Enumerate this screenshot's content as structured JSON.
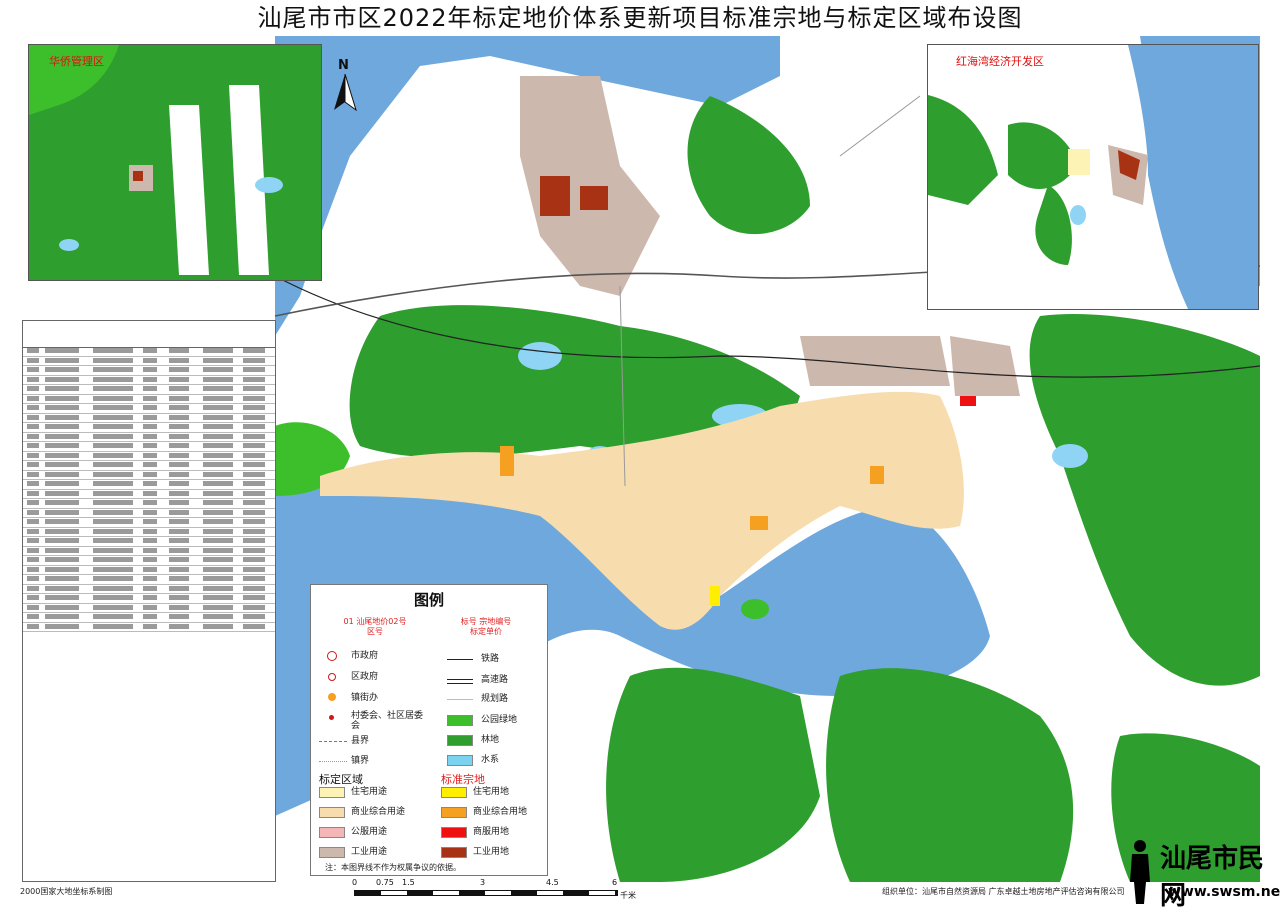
{
  "title": "汕尾市市区2022年标定地价体系更新项目标准宗地与标定区域布设图",
  "north_label": "N",
  "insets": {
    "left_label": "华侨管理区",
    "right_label": "红海湾经济开发区"
  },
  "legend": {
    "title": "图例",
    "red_note_left": "01 汕尾地价02号\n区号",
    "red_note_right": "标号 宗地编号\n标定单价",
    "symbols": [
      {
        "label": "市政府",
        "icon": "government-icon"
      },
      {
        "label": "区政府",
        "icon": "district-gov-icon"
      },
      {
        "label": "镇街办",
        "icon": "town-office-icon"
      },
      {
        "label": "村委会、社区居委会",
        "icon": "village-icon"
      },
      {
        "label": "县界",
        "icon": "county-border-icon"
      },
      {
        "label": "镇界",
        "icon": "town-border-icon"
      }
    ],
    "lines": [
      {
        "label": "铁路",
        "icon": "railway-icon"
      },
      {
        "label": "高速路",
        "icon": "highway-icon"
      },
      {
        "label": "规划路",
        "icon": "planned-road-icon"
      }
    ],
    "areas": [
      {
        "label": "公园绿地",
        "color": "#3cbf2a"
      },
      {
        "label": "林地",
        "color": "#2f9e2f"
      },
      {
        "label": "水系",
        "color": "#7cd3f0"
      }
    ],
    "zone_heading": "标定区域",
    "zones": [
      {
        "label": "住宅用途",
        "color": "#fdf3b5"
      },
      {
        "label": "商业综合用途",
        "color": "#f7dcae"
      },
      {
        "label": "公服用途",
        "color": "#f4b6b6"
      },
      {
        "label": "工业用途",
        "color": "#cdb8ad"
      }
    ],
    "parcel_heading": "标准宗地",
    "parcels": [
      {
        "label": "住宅用地",
        "color": "#ffee00"
      },
      {
        "label": "商业综合用地",
        "color": "#f5a020"
      },
      {
        "label": "商服用地",
        "color": "#ee1111"
      },
      {
        "label": "工业用地",
        "color": "#a83214"
      }
    ],
    "footnote": "注：本图界线不作为权属争议的依据。"
  },
  "scale": {
    "ticks": [
      "0",
      "0.75",
      "1.5",
      "3",
      "4.5",
      "6"
    ],
    "unit": "千米"
  },
  "footer": {
    "left": "2000国家大地坐标系制图",
    "right": "组织单位：汕尾市自然资源局  广东卓越土地房地产评估咨询有限公司"
  },
  "watermark": {
    "text": "汕尾市民网",
    "url": "www.swsm.net"
  },
  "colors": {
    "sea": "#6fa8dc",
    "forest": "#2e9e2e",
    "park": "#3cbf2a",
    "lake": "#8fd4f5",
    "industrial": "#cdb8ad",
    "commercial": "#f7dcae",
    "residential": "#fdf3b5"
  }
}
